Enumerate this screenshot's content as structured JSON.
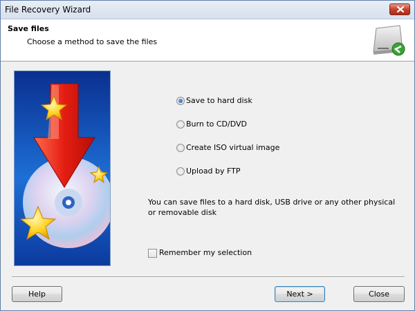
{
  "window": {
    "title": "File Recovery Wizard"
  },
  "header": {
    "title": "Save files",
    "subtitle": "Choose a method to save the files"
  },
  "options": [
    {
      "label": "Save to hard disk",
      "selected": true
    },
    {
      "label": "Burn to CD/DVD",
      "selected": false
    },
    {
      "label": "Create ISO virtual image",
      "selected": false
    },
    {
      "label": "Upload by FTP",
      "selected": false
    }
  ],
  "description": "You can save files to a hard disk, USB drive or any other physical or removable disk",
  "remember": {
    "label": "Remember my selection",
    "checked": false
  },
  "buttons": {
    "help": "Help",
    "next": "Next >",
    "close": "Close"
  },
  "icons": {
    "close": "close-icon",
    "drive": "hard-drive-icon",
    "side": "disc-download-illustration"
  },
  "colors": {
    "titlebar": "#dbe4f1",
    "header_bg": "#ffffff",
    "body_bg": "#f0f0f0",
    "close_button": "#c4412d"
  }
}
